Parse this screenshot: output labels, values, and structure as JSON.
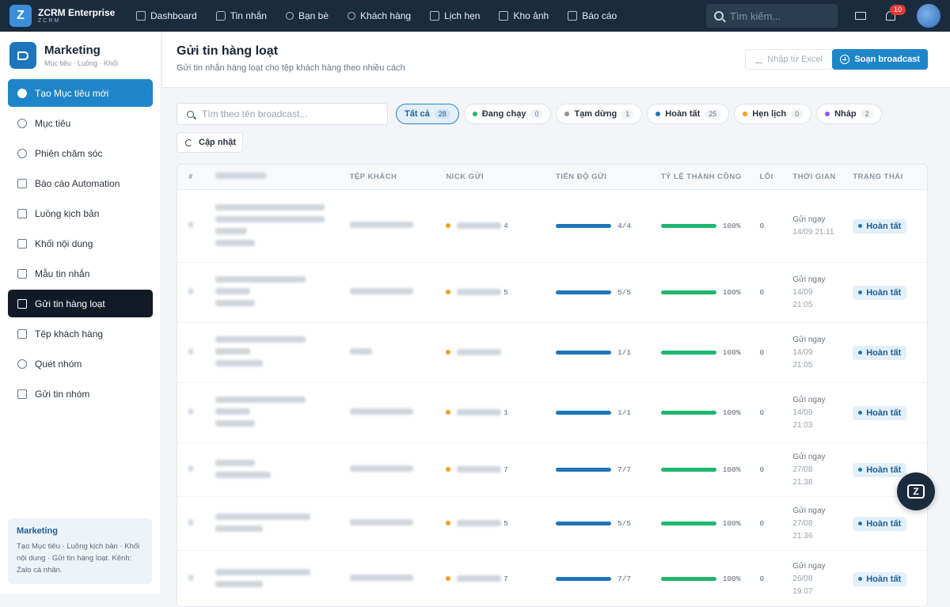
{
  "brand": {
    "name": "ZCRM Enterprise",
    "sub": "ZCRM",
    "logo_letter": "Z"
  },
  "topnav": [
    {
      "label": "Dashboard",
      "icon": "grid-icon"
    },
    {
      "label": "Tin nhắn",
      "icon": "chat-icon"
    },
    {
      "label": "Bạn bè",
      "icon": "friends-icon"
    },
    {
      "label": "Khách hàng",
      "icon": "customer-icon"
    },
    {
      "label": "Lịch hẹn",
      "icon": "calendar-icon"
    },
    {
      "label": "Kho ảnh",
      "icon": "image-icon"
    },
    {
      "label": "Báo cáo",
      "icon": "report-icon"
    }
  ],
  "top_search": {
    "placeholder": "Tìm kiếm..."
  },
  "notifications": {
    "count": "10"
  },
  "sidebar": {
    "title": "Marketing",
    "subtitle": "Mục tiêu · Luồng · Khối",
    "items": [
      {
        "label": "Tạo Mục tiêu mới",
        "icon": "plus-circle-icon"
      },
      {
        "label": "Mục tiêu",
        "icon": "target-icon"
      },
      {
        "label": "Phiên chăm sóc",
        "icon": "users-icon"
      },
      {
        "label": "Báo cáo Automation",
        "icon": "report-icon"
      },
      {
        "label": "Luồng kịch bản",
        "icon": "list-icon"
      },
      {
        "label": "Khối nội dung",
        "icon": "puzzle-icon"
      },
      {
        "label": "Mẫu tin nhắn",
        "icon": "message-icon"
      },
      {
        "label": "Gửi tin hàng loạt",
        "icon": "megaphone-icon"
      },
      {
        "label": "Tệp khách hàng",
        "icon": "folder-icon"
      },
      {
        "label": "Quét nhóm",
        "icon": "group-icon"
      },
      {
        "label": "Gửi tin nhóm",
        "icon": "send-icon"
      }
    ],
    "footer": {
      "title": "Marketing",
      "text": "Tạo Mục tiêu · Luồng kịch bản · Khối nội dung · Gửi tin hàng loạt. Kênh: Zalo cá nhân."
    }
  },
  "page": {
    "title": "Gửi tin hàng loạt",
    "subtitle": "Gửi tin nhắn hàng loạt cho tệp khách hàng theo nhiều cách",
    "import_label": "Nhập từ Excel",
    "compose_label": "Soạn broadcast",
    "search_placeholder": "Tìm theo tên broadcast...",
    "refresh_label": "Cập nhật"
  },
  "filters": [
    {
      "label": "Tất cả",
      "count": "28",
      "color": ""
    },
    {
      "label": "Đang chạy",
      "count": "0",
      "color": "#1fb670"
    },
    {
      "label": "Tạm dừng",
      "count": "1",
      "color": "#8a95a3"
    },
    {
      "label": "Hoàn tất",
      "count": "25",
      "color": "#1f75b9"
    },
    {
      "label": "Hẹn lịch",
      "count": "0",
      "color": "#f0a020"
    },
    {
      "label": "Nháp",
      "count": "2",
      "color": "#8b5cf6"
    }
  ],
  "table": {
    "columns": [
      "#",
      "",
      "TỆP KHÁCH",
      "NICK GỬI",
      "TIẾN ĐỘ GỬI",
      "TỶ LỆ THÀNH CÔNG",
      "LỖI",
      "THỜI GIAN",
      "TRẠNG THÁI"
    ],
    "rows": [
      {
        "nick_count": "4",
        "progress": "4/4",
        "progress_pct": 100,
        "rate": "100%",
        "rate_pct": 100,
        "errors": "0",
        "time_a": "Gửi ngay",
        "time_b": "14/09 21:11",
        "time_c": "",
        "status": "Hoàn tất"
      },
      {
        "nick_count": "5",
        "progress": "5/5",
        "progress_pct": 100,
        "rate": "100%",
        "rate_pct": 100,
        "errors": "0",
        "time_a": "Gửi ngay",
        "time_b": "14/09",
        "time_c": "21:05",
        "status": "Hoàn tất"
      },
      {
        "nick_count": "",
        "progress": "1/1",
        "progress_pct": 100,
        "rate": "100%",
        "rate_pct": 100,
        "errors": "0",
        "time_a": "Gửi ngay",
        "time_b": "14/09",
        "time_c": "21:05",
        "status": "Hoàn tất"
      },
      {
        "nick_count": "1",
        "progress": "1/1",
        "progress_pct": 100,
        "rate": "100%",
        "rate_pct": 100,
        "errors": "0",
        "time_a": "Gửi ngay",
        "time_b": "14/09",
        "time_c": "21:03",
        "status": "Hoàn tất"
      },
      {
        "nick_count": "7",
        "progress": "7/7",
        "progress_pct": 100,
        "rate": "100%",
        "rate_pct": 100,
        "errors": "0",
        "time_a": "Gửi ngay",
        "time_b": "27/08",
        "time_c": "21:38",
        "status": "Hoàn tất"
      },
      {
        "nick_count": "5",
        "progress": "5/5",
        "progress_pct": 100,
        "rate": "100%",
        "rate_pct": 100,
        "errors": "0",
        "time_a": "Gửi ngay",
        "time_b": "27/08",
        "time_c": "21:36",
        "status": "Hoàn tất"
      },
      {
        "nick_count": "7",
        "progress": "7/7",
        "progress_pct": 100,
        "rate": "100%",
        "rate_pct": 100,
        "errors": "0",
        "time_a": "Gửi ngay",
        "time_b": "26/08",
        "time_c": "19:07",
        "status": "Hoàn tất"
      }
    ]
  },
  "fab": {
    "letter": "Z"
  }
}
